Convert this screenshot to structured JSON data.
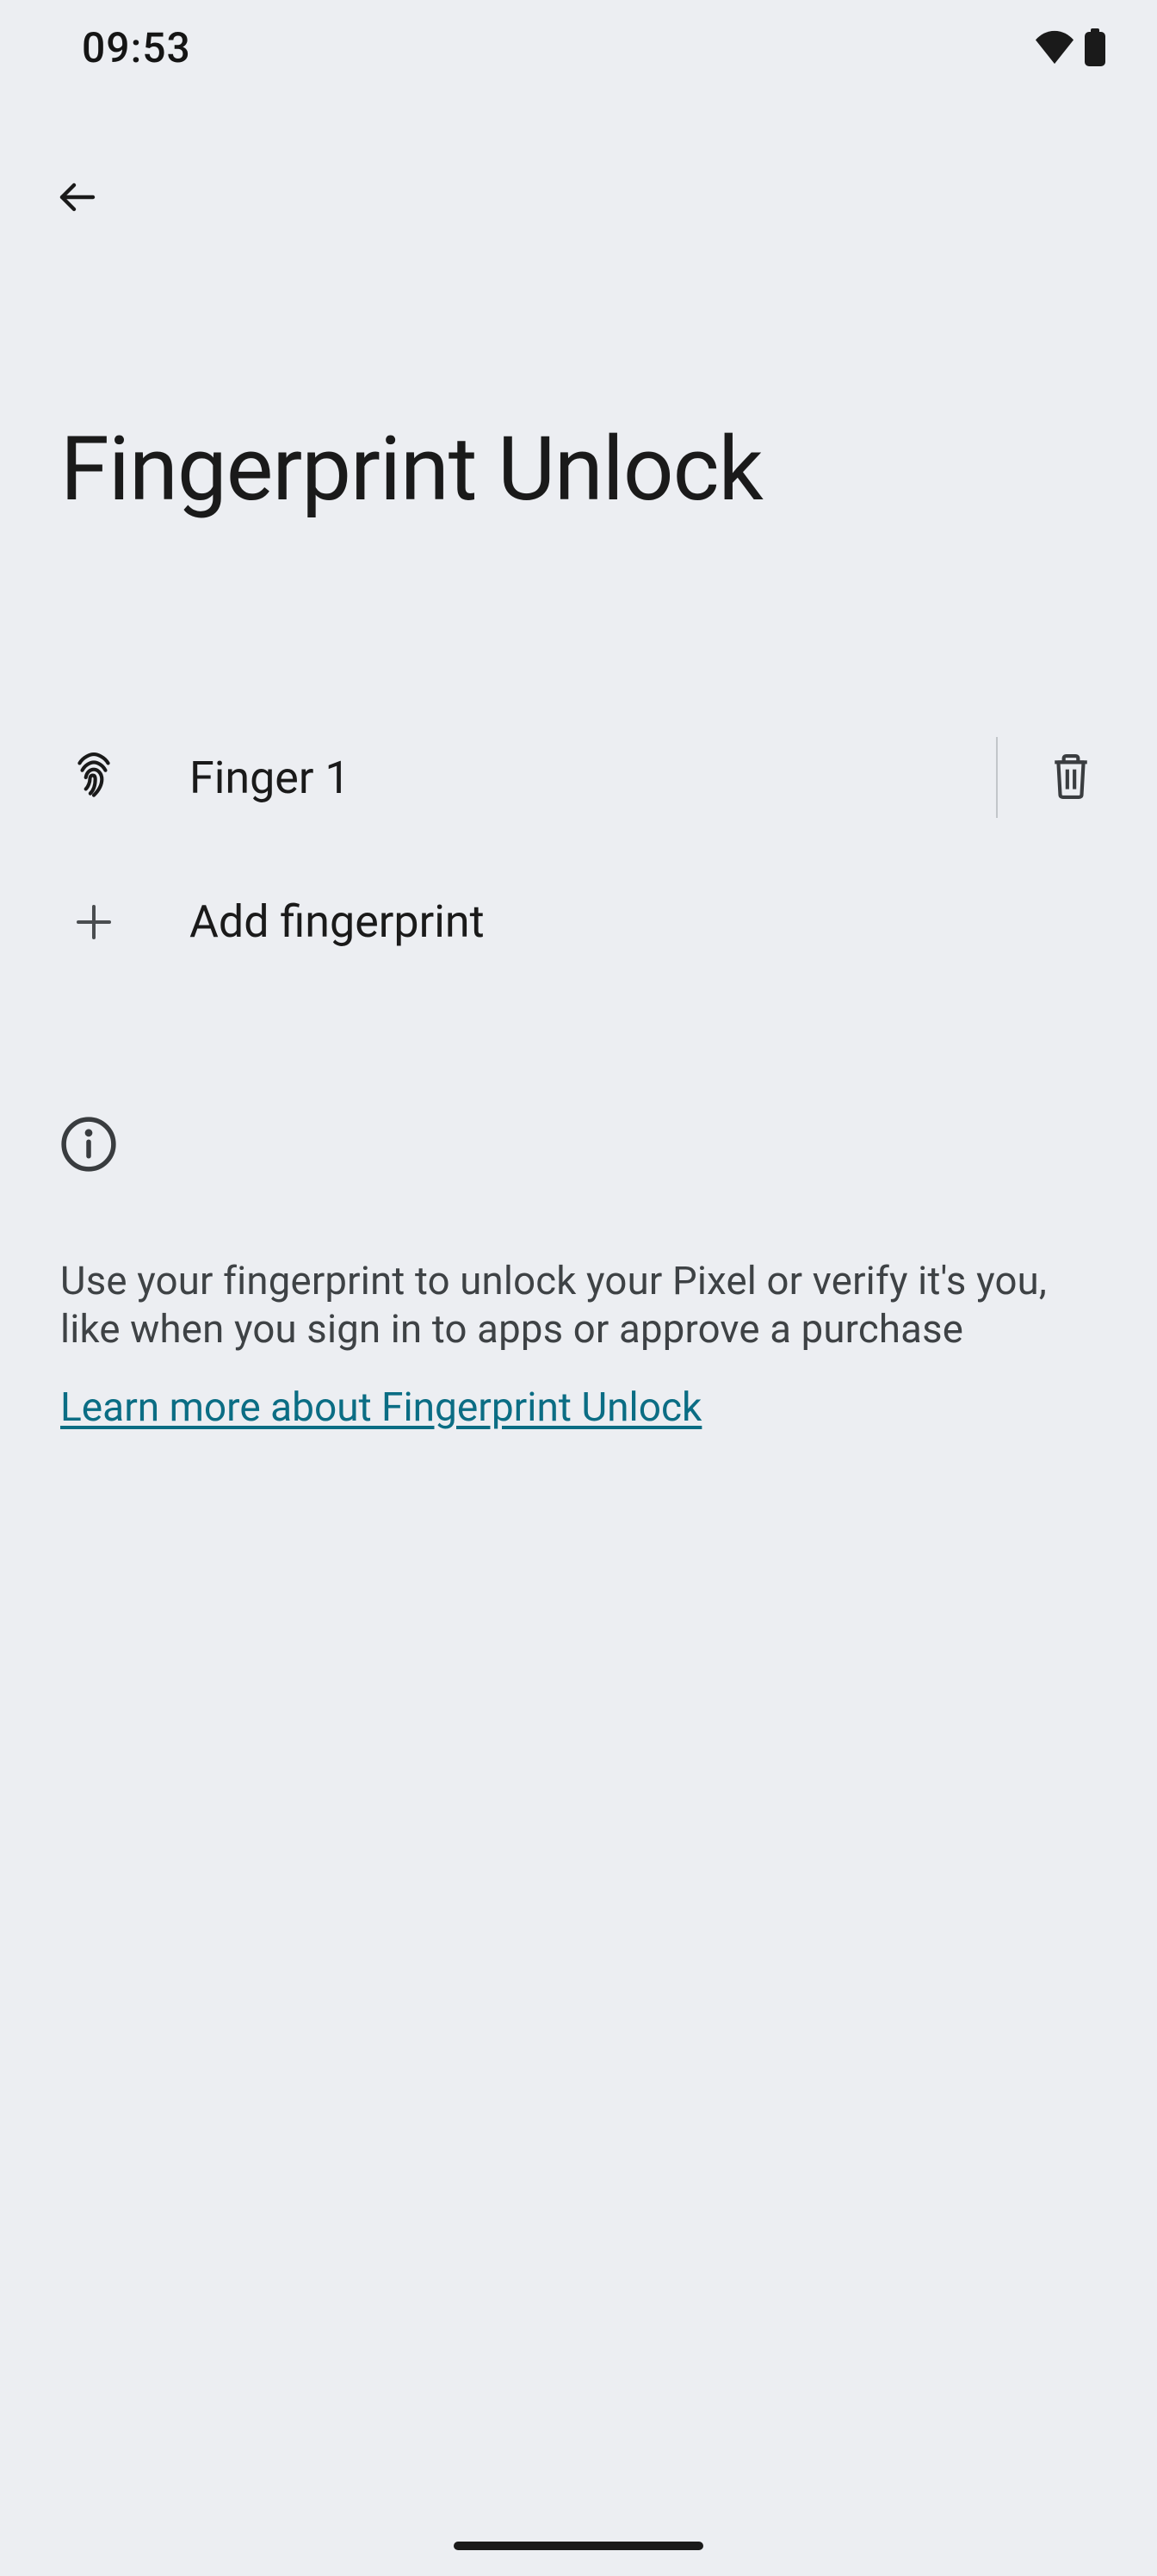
{
  "status": {
    "time": "09:53"
  },
  "page": {
    "title": "Fingerprint Unlock"
  },
  "fingerprints": [
    {
      "name": "Finger 1"
    }
  ],
  "actions": {
    "add_label": "Add fingerprint"
  },
  "info": {
    "body": "Use your fingerprint to unlock your Pixel or verify it's you, like when you sign in to apps or approve a purchase",
    "link": "Learn more about Fingerprint Unlock"
  }
}
